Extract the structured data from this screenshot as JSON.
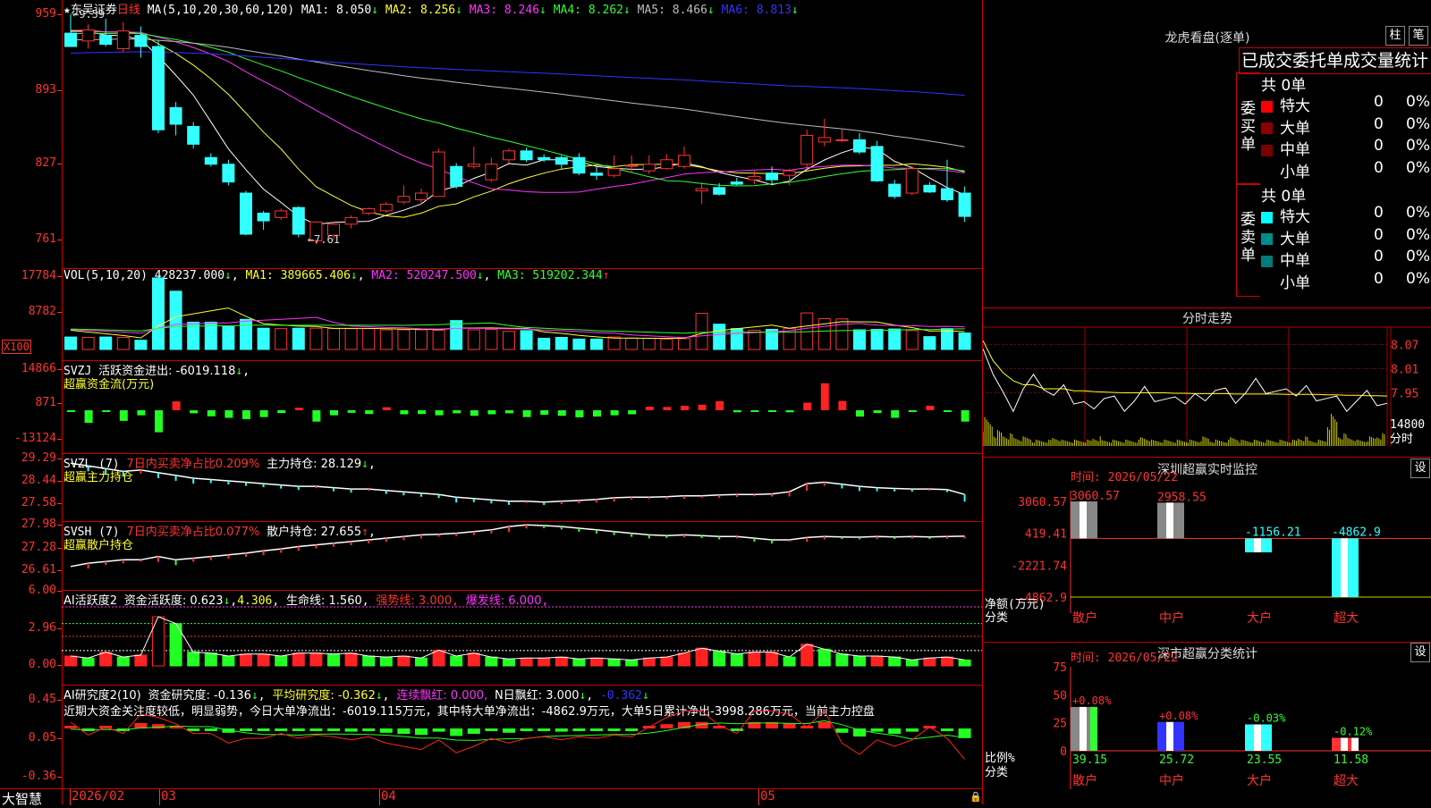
{
  "stock": {
    "star": "★",
    "name": "东吴证券",
    "period": "日线"
  },
  "price": {
    "ma_def": "MA(5,10,20,30,60,120)",
    "ma": [
      {
        "label": "MA1:",
        "value": "8.050",
        "arrow": "↓",
        "color": "#ffffff"
      },
      {
        "label": "MA2:",
        "value": "8.256",
        "arrow": "↓",
        "color": "#ffff33"
      },
      {
        "label": "MA3:",
        "value": "8.246",
        "arrow": "↓",
        "color": "#ff33ff"
      },
      {
        "label": "MA4:",
        "value": "8.262",
        "arrow": "↓",
        "color": "#33ff33"
      },
      {
        "label": "MA5:",
        "value": "8.466",
        "arrow": "↓",
        "color": "#bbbbbb"
      },
      {
        "label": "MA6:",
        "value": "8.813",
        "arrow": "↓",
        "color": "#3333ff"
      }
    ],
    "y_labels": [
      "959",
      "893",
      "827",
      "761"
    ],
    "high_mark": "9.59",
    "low_mark": "7.61",
    "candles": [
      {
        "o": 9.42,
        "h": 9.59,
        "l": 9.36,
        "c": 9.3
      },
      {
        "o": 9.35,
        "h": 9.5,
        "l": 9.28,
        "c": 9.45
      },
      {
        "o": 9.4,
        "h": 9.55,
        "l": 9.3,
        "c": 9.32
      },
      {
        "o": 9.28,
        "h": 9.52,
        "l": 9.25,
        "c": 9.44
      },
      {
        "o": 9.4,
        "h": 9.48,
        "l": 9.2,
        "c": 9.3
      },
      {
        "o": 9.3,
        "h": 9.36,
        "l": 8.52,
        "c": 8.55
      },
      {
        "o": 8.75,
        "h": 8.8,
        "l": 8.5,
        "c": 8.6
      },
      {
        "o": 8.58,
        "h": 8.62,
        "l": 8.38,
        "c": 8.42
      },
      {
        "o": 8.3,
        "h": 8.34,
        "l": 8.22,
        "c": 8.24
      },
      {
        "o": 8.24,
        "h": 8.28,
        "l": 8.05,
        "c": 8.08
      },
      {
        "o": 7.98,
        "h": 8.0,
        "l": 7.6,
        "c": 7.61
      },
      {
        "o": 7.8,
        "h": 7.82,
        "l": 7.65,
        "c": 7.73
      },
      {
        "o": 7.76,
        "h": 7.84,
        "l": 7.74,
        "c": 7.82
      },
      {
        "o": 7.85,
        "h": 7.86,
        "l": 7.58,
        "c": 7.61
      },
      {
        "o": 7.55,
        "h": 7.72,
        "l": 7.52,
        "c": 7.72
      },
      {
        "o": 7.6,
        "h": 7.72,
        "l": 7.55,
        "c": 7.7
      },
      {
        "o": 7.7,
        "h": 7.78,
        "l": 7.66,
        "c": 7.76
      },
      {
        "o": 7.8,
        "h": 7.85,
        "l": 7.78,
        "c": 7.84
      },
      {
        "o": 7.82,
        "h": 7.9,
        "l": 7.8,
        "c": 7.88
      },
      {
        "o": 7.9,
        "h": 8.05,
        "l": 7.88,
        "c": 7.95
      },
      {
        "o": 7.92,
        "h": 8.02,
        "l": 7.88,
        "c": 7.98
      },
      {
        "o": 7.95,
        "h": 8.38,
        "l": 7.95,
        "c": 8.35
      },
      {
        "o": 8.22,
        "h": 8.25,
        "l": 8.02,
        "c": 8.04
      },
      {
        "o": 8.22,
        "h": 8.4,
        "l": 8.2,
        "c": 8.24
      },
      {
        "o": 8.1,
        "h": 8.3,
        "l": 8.08,
        "c": 8.24
      },
      {
        "o": 8.28,
        "h": 8.38,
        "l": 8.25,
        "c": 8.36
      },
      {
        "o": 8.36,
        "h": 8.39,
        "l": 8.26,
        "c": 8.28
      },
      {
        "o": 8.3,
        "h": 8.33,
        "l": 8.26,
        "c": 8.28
      },
      {
        "o": 8.3,
        "h": 8.32,
        "l": 8.2,
        "c": 8.24
      },
      {
        "o": 8.3,
        "h": 8.34,
        "l": 8.14,
        "c": 8.16
      },
      {
        "o": 8.16,
        "h": 8.22,
        "l": 8.1,
        "c": 8.14
      },
      {
        "o": 8.14,
        "h": 8.32,
        "l": 8.12,
        "c": 8.2
      },
      {
        "o": 8.22,
        "h": 8.32,
        "l": 8.16,
        "c": 8.23
      },
      {
        "o": 8.18,
        "h": 8.32,
        "l": 8.15,
        "c": 8.24
      },
      {
        "o": 8.2,
        "h": 8.33,
        "l": 8.19,
        "c": 8.28
      },
      {
        "o": 8.22,
        "h": 8.4,
        "l": 8.2,
        "c": 8.32
      },
      {
        "o": 8.0,
        "h": 8.08,
        "l": 7.88,
        "c": 8.02
      },
      {
        "o": 8.03,
        "h": 8.07,
        "l": 7.96,
        "c": 7.97
      },
      {
        "o": 8.08,
        "h": 8.12,
        "l": 8.05,
        "c": 8.06
      },
      {
        "o": 8.1,
        "h": 8.18,
        "l": 8.06,
        "c": 8.13
      },
      {
        "o": 8.16,
        "h": 8.22,
        "l": 8.06,
        "c": 8.1
      },
      {
        "o": 8.14,
        "h": 8.2,
        "l": 8.05,
        "c": 8.18
      },
      {
        "o": 8.24,
        "h": 8.55,
        "l": 8.2,
        "c": 8.5
      },
      {
        "o": 8.44,
        "h": 8.65,
        "l": 8.4,
        "c": 8.48
      },
      {
        "o": 8.46,
        "h": 8.55,
        "l": 8.44,
        "c": 8.46
      },
      {
        "o": 8.46,
        "h": 8.52,
        "l": 8.33,
        "c": 8.35
      },
      {
        "o": 8.4,
        "h": 8.45,
        "l": 8.08,
        "c": 8.09
      },
      {
        "o": 8.06,
        "h": 8.1,
        "l": 7.93,
        "c": 7.95
      },
      {
        "o": 7.98,
        "h": 8.22,
        "l": 7.96,
        "c": 8.2
      },
      {
        "o": 8.05,
        "h": 8.08,
        "l": 7.98,
        "c": 7.99
      },
      {
        "o": 8.02,
        "h": 8.28,
        "l": 7.9,
        "c": 7.92
      },
      {
        "o": 7.98,
        "h": 8.04,
        "l": 7.72,
        "c": 7.77
      }
    ]
  },
  "vol": {
    "def": "VOL(5,10,20)",
    "value": "428237.000",
    "arrow1": "↓",
    "ma1": "MA1: 389665.406",
    "ma1_arrow": "↓",
    "ma2": "MA2: 520247.500",
    "ma2_arrow": "↓",
    "ma3": "MA3: 519202.344",
    "ma3_arrow": "↑",
    "y_labels": [
      "17784",
      "8782"
    ],
    "unit": "X100",
    "values": [
      3100,
      3000,
      3100,
      3000,
      2300,
      17800,
      14500,
      6800,
      6800,
      5700,
      7500,
      5300,
      5200,
      5300,
      5300,
      5200,
      5200,
      5200,
      4900,
      4900,
      4900,
      4800,
      7200,
      4900,
      5000,
      4500,
      4700,
      2800,
      3000,
      2600,
      2600,
      3100,
      2800,
      2800,
      2600,
      2700,
      9000,
      6300,
      5200,
      4800,
      5000,
      5200,
      9100,
      7700,
      7600,
      4900,
      5000,
      5100,
      4700,
      3200,
      5200,
      4100
    ]
  },
  "svzj": {
    "name": "SVZJ",
    "label": "活跃资金进出: -6019.118",
    "arrow": "↓",
    "tail": ",",
    "sub": "超赢资金流(万元)",
    "y_labels": [
      "14866",
      "871",
      "-13124"
    ],
    "values": [
      -500,
      -5000,
      -300,
      -4200,
      -2000,
      -8700,
      3500,
      -1200,
      -2400,
      -3000,
      -3500,
      -2700,
      -1100,
      1000,
      -4500,
      -2000,
      -1000,
      -1500,
      1200,
      -1600,
      -1500,
      -2000,
      -1200,
      -2200,
      -1600,
      -1200,
      -2700,
      -1800,
      -2200,
      -2800,
      -2500,
      -2000,
      -1600,
      1400,
      1300,
      1800,
      2200,
      3600,
      -800,
      -600,
      -500,
      -800,
      3000,
      10700,
      3700,
      -2500,
      -1100,
      -3000,
      -500,
      1800,
      -500,
      -4500
    ]
  },
  "svzl": {
    "name": "SVZL",
    "def": "(7)",
    "label1": "7日内买卖净占比0.209%",
    "label2": "主力持仓: 28.129",
    "arrow": "↓",
    "tail": ",",
    "sub": "超赢主力持仓",
    "y_labels": [
      "29.29",
      "28.44",
      "27.58"
    ],
    "values": [
      29.15,
      29.05,
      28.95,
      28.85,
      28.9,
      28.8,
      28.7,
      28.6,
      28.55,
      28.5,
      28.45,
      28.4,
      28.35,
      28.3,
      28.3,
      28.25,
      28.2,
      28.2,
      28.15,
      28.1,
      28.05,
      28.0,
      27.9,
      27.85,
      27.8,
      27.75,
      27.75,
      27.72,
      27.75,
      27.78,
      27.82,
      27.88,
      27.9,
      27.9,
      27.92,
      27.95,
      27.95,
      27.98,
      28.0,
      28.0,
      28.02,
      28.1,
      28.4,
      28.45,
      28.38,
      28.3,
      28.25,
      28.22,
      28.2,
      28.2,
      28.18,
      28.0
    ]
  },
  "svsh": {
    "name": "SVSH",
    "def": "(7)",
    "label1": "7日内买卖净占比0.077%",
    "label2": "散户持仓: 27.655",
    "arrow": "↑",
    "tail": ",",
    "sub": "超赢散户持仓",
    "y_labels": [
      "27.98",
      "27.28",
      "26.61"
    ],
    "values": [
      26.75,
      26.85,
      26.9,
      26.95,
      26.95,
      27.05,
      26.95,
      27.0,
      27.05,
      27.1,
      27.15,
      27.22,
      27.28,
      27.35,
      27.4,
      27.45,
      27.5,
      27.55,
      27.6,
      27.65,
      27.7,
      27.72,
      27.75,
      27.8,
      27.85,
      27.95,
      28.0,
      27.98,
      27.95,
      27.9,
      27.85,
      27.8,
      27.75,
      27.7,
      27.68,
      27.7,
      27.68,
      27.65,
      27.65,
      27.6,
      27.55,
      27.55,
      27.62,
      27.65,
      27.64,
      27.63,
      27.65,
      27.64,
      27.65,
      27.64,
      27.65,
      27.66
    ]
  },
  "ai_active": {
    "name": "AI活跃度2",
    "label": "资金活跃度: 0.623",
    "arrow": "↓",
    "val2": "4.306",
    "life": "生命线: 1.560",
    "strong": "强势线: 3.000",
    "burst": "爆发线: 6.000",
    "y_labels": [
      "6.00",
      "2.96",
      "0.00"
    ],
    "values": [
      1.0,
      0.8,
      1.4,
      0.9,
      1.1,
      5.0,
      4.3,
      1.4,
      1.3,
      1.0,
      1.2,
      1.2,
      1.0,
      1.3,
      1.3,
      1.2,
      1.3,
      1.0,
      0.9,
      1.0,
      0.8,
      1.6,
      1.0,
      1.3,
      0.9,
      0.7,
      0.8,
      0.8,
      0.9,
      0.7,
      0.8,
      0.7,
      0.6,
      0.8,
      0.9,
      1.3,
      1.8,
      1.5,
      1.2,
      1.4,
      1.4,
      0.9,
      2.2,
      1.7,
      1.2,
      1.0,
      1.0,
      0.9,
      0.6,
      0.8,
      0.9,
      0.6
    ]
  },
  "ai_research": {
    "name": "AI研究度2(10)",
    "label": "资金研究度: -0.136",
    "arrow": "↓",
    "avg": "平均研究度: -0.362",
    "avg_arrow": "↓",
    "cont": "连续飘红: 0.000,",
    "n": "N日飘红: 3.000",
    "n_arrow": "↓",
    "last": "-0.362",
    "last_arrow": "↓",
    "y_labels": [
      "0.45",
      "0.05",
      "-0.36"
    ],
    "text": "近期大资金关注度较低，明显弱势，今日大单净流出：-6019.115万元，其中特大单净流出：-4862.9万元，大单5日累计净出-3998.286万元，当前主力控盘",
    "values": [
      0.05,
      -0.03,
      0.02,
      -0.02,
      0.1,
      0.08,
      0.04,
      -0.02,
      -0.02,
      -0.08,
      -0.05,
      -0.05,
      -0.02,
      -0.05,
      -0.03,
      -0.04,
      -0.06,
      -0.04,
      -0.08,
      -0.1,
      -0.12,
      -0.06,
      -0.14,
      -0.1,
      -0.05,
      -0.08,
      -0.05,
      -0.04,
      -0.06,
      -0.04,
      -0.05,
      -0.03,
      -0.04,
      0.02,
      0.08,
      0.12,
      0.12,
      0.03,
      -0.02,
      0.12,
      0.12,
      0.1,
      0.02,
      0.12,
      -0.08,
      -0.15,
      -0.06,
      -0.1,
      -0.06,
      0.02,
      -0.05,
      -0.18
    ]
  },
  "xaxis": {
    "brand": "大智慧",
    "labels": [
      "2026/02",
      "03",
      "04",
      "05"
    ]
  },
  "dragon": {
    "title": "龙虎看盘(逐单)",
    "btn1": "柱",
    "btn2": "笔",
    "tabs": "已成交委托单成交量统计",
    "buy": {
      "side": "委买单",
      "total": "共 0单",
      "rows": [
        {
          "name": "特大",
          "count": "0",
          "pct": "0%",
          "color": "#ff0000"
        },
        {
          "name": "大单",
          "count": "0",
          "pct": "0%",
          "color": "#8b0000"
        },
        {
          "name": "中单",
          "count": "0",
          "pct": "0%",
          "color": "#7a0000"
        },
        {
          "name": "小单",
          "count": "0",
          "pct": "0%",
          "color": "#000000"
        }
      ]
    },
    "sell": {
      "side": "委卖单",
      "total": "共 0单",
      "rows": [
        {
          "name": "特大",
          "count": "0",
          "pct": "0%",
          "color": "#00ffff"
        },
        {
          "name": "大单",
          "count": "0",
          "pct": "0%",
          "color": "#008b8b"
        },
        {
          "name": "中单",
          "count": "0",
          "pct": "0%",
          "color": "#007a7a"
        },
        {
          "name": "小单",
          "count": "0",
          "pct": "0%",
          "color": "#000000"
        }
      ]
    }
  },
  "intraday": {
    "title": "分时走势",
    "y_labels": [
      "8.07",
      "8.01",
      "7.95"
    ],
    "vol_label": "14800",
    "unit": "分时",
    "prices": [
      8.08,
      8.0,
      7.94,
      7.92,
      7.96,
      7.98,
      7.97,
      7.94,
      7.95,
      7.93,
      7.92,
      7.93,
      7.94,
      7.93,
      7.92,
      7.93,
      7.95,
      7.94,
      7.93,
      7.92,
      7.93,
      7.94,
      7.95,
      7.96,
      7.95,
      7.94,
      7.95,
      7.97,
      7.96,
      7.95,
      7.94,
      7.95,
      7.96,
      7.95,
      7.94,
      7.93,
      7.92,
      7.93,
      7.94,
      7.93,
      7.92
    ],
    "avg": [
      8.08,
      8.03,
      8.0,
      7.98,
      7.97,
      7.97,
      7.96,
      7.96,
      7.96,
      7.955,
      7.955,
      7.953,
      7.952,
      7.951,
      7.95,
      7.95,
      7.95,
      7.95,
      7.95,
      7.949,
      7.949,
      7.948,
      7.948,
      7.948,
      7.948,
      7.947,
      7.947,
      7.947,
      7.947,
      7.947,
      7.946,
      7.946,
      7.946,
      7.946,
      7.945,
      7.945,
      7.944,
      7.944,
      7.943,
      7.943,
      7.942
    ],
    "vols": [
      9,
      5,
      4,
      3,
      3,
      2,
      2,
      3,
      2,
      2,
      2,
      3,
      2,
      2,
      2,
      2,
      3,
      2,
      2,
      2,
      2,
      2,
      3,
      2,
      2,
      3,
      2,
      2,
      2,
      2,
      2,
      2,
      3,
      2,
      2,
      10,
      4,
      3,
      2,
      3,
      4
    ]
  },
  "sz_monitor": {
    "title": "深圳超赢实时监控",
    "btn": "设",
    "time": "时间: 2026/05/22",
    "y_labels": [
      "3060.57",
      "419.41",
      "-2221.74",
      "-4862.9"
    ],
    "unit1": "净额(万元)",
    "unit2": "分类",
    "bars": [
      {
        "name": "散户",
        "value": 3060.57,
        "label": "3060.57",
        "color": "#ffffff"
      },
      {
        "name": "中户",
        "value": 2958.55,
        "label": "2958.55",
        "color": "#ffffff"
      },
      {
        "name": "大户",
        "value": -1156.21,
        "label": "-1156.21",
        "color": "#3ff"
      },
      {
        "name": "超大",
        "value": -4862.9,
        "label": "-4862.9",
        "color": "#3ff"
      }
    ]
  },
  "sz_class": {
    "title": "深市超赢分类统计",
    "btn": "设",
    "time": "时间: 2026/05/22",
    "y_labels": [
      "75",
      "50",
      "25",
      "0"
    ],
    "unit1": "比例%",
    "unit2": "分类",
    "bars": [
      {
        "name": "散户",
        "value": 39.15,
        "label": "39.15",
        "delta": "+0.08%",
        "color": "#ffffff",
        "accent": "#3f3"
      },
      {
        "name": "中户",
        "value": 25.72,
        "label": "25.72",
        "delta": "+0.08%",
        "color": "#3333ff",
        "accent": "#3333ff"
      },
      {
        "name": "大户",
        "value": 23.55,
        "label": "23.55",
        "delta": "-0.03%",
        "color": "#3ff",
        "accent": "#3ff"
      },
      {
        "name": "超大",
        "value": 11.58,
        "label": "11.58",
        "delta": "-0.12%",
        "color": "#f33",
        "accent": "#ffffff"
      }
    ]
  }
}
